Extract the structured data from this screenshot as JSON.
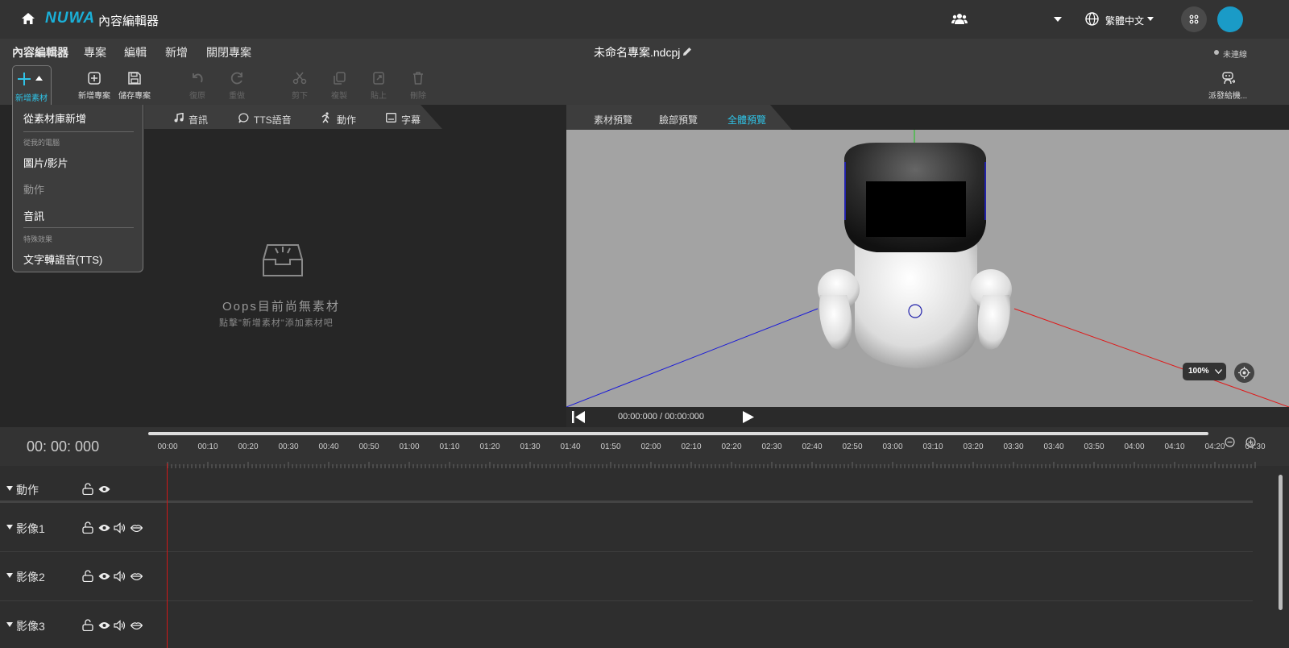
{
  "app": {
    "brand": "NUWA",
    "title": "內容編輯器",
    "language": "繁體中文",
    "accent": "#1a9bc7"
  },
  "menu": {
    "items": [
      "內容編輯器",
      "專案",
      "編輯",
      "新增",
      "關閉專案"
    ],
    "project_name": "未命名專案.ndcpj",
    "connection_status": "未連線"
  },
  "toolbar": {
    "add_asset": "新增素材",
    "new_project": "新增專案",
    "save_project": "儲存專案",
    "undo": "復原",
    "redo": "重做",
    "cut": "剪下",
    "copy": "複製",
    "paste": "貼上",
    "delete": "刪除",
    "dispatch": "派發給機..."
  },
  "dropdown": {
    "from_library": "從素材庫新增",
    "from_computer_section": "從我的電腦",
    "image_video": "圖片/影片",
    "motion": "動作",
    "audio": "音訊",
    "effects_section": "特殊效果",
    "tts": "文字轉語音(TTS)"
  },
  "asset_tabs": [
    "音訊",
    "TTS語音",
    "動作",
    "字幕"
  ],
  "empty_state": {
    "title": "Oops目前尚無素材",
    "hint": "點擊\"新增素材\"添加素材吧"
  },
  "preview_tabs": [
    "素材預覽",
    "臉部預覽",
    "全體預覽"
  ],
  "preview": {
    "zoom": "100%",
    "time": "00:00:000 / 00:00:000"
  },
  "timeline": {
    "current_time": "00: 00: 000",
    "ticks": [
      "00:00",
      "00:10",
      "00:20",
      "00:30",
      "00:40",
      "00:50",
      "01:00",
      "01:10",
      "01:20",
      "01:30",
      "01:40",
      "01:50",
      "02:00",
      "02:10",
      "02:20",
      "02:30",
      "02:40",
      "02:50",
      "03:00",
      "03:10",
      "03:20",
      "03:30",
      "03:40",
      "03:50",
      "04:00",
      "04:10",
      "04:20",
      "04:30"
    ],
    "tracks": [
      "動作",
      "影像1",
      "影像2",
      "影像3"
    ]
  }
}
